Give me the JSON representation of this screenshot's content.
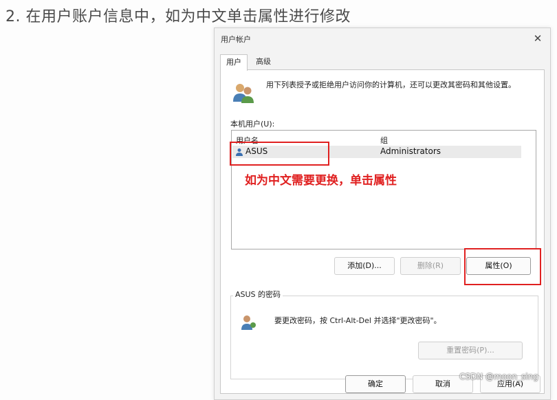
{
  "step_text": "2. 在用户账户信息中，如为中文单击属性进行修改",
  "dialog": {
    "title": "用户帐户",
    "close_glyph": "✕",
    "tabs": [
      {
        "label": "用户",
        "active": true
      },
      {
        "label": "高级",
        "active": false
      }
    ],
    "intro_text": "用下列表授予或拒绝用户访问你的计算机，还可以更改其密码和其他设置。",
    "local_users_label": "本机用户(U):",
    "columns": {
      "name": "用户名",
      "group": "组"
    },
    "users": [
      {
        "name": "ASUS",
        "group": "Administrators",
        "selected": true
      }
    ],
    "buttons": {
      "add": "添加(D)...",
      "remove": "删除(R)",
      "properties": "属性(O)"
    },
    "password_group": {
      "title": "ASUS 的密码",
      "text": "要更改密码，按 Ctrl-Alt-Del 并选择\"更改密码\"。",
      "reset_button": "重置密码(P)..."
    },
    "footer": {
      "ok": "确定",
      "cancel": "取消",
      "apply": "应用(A)"
    }
  },
  "annotation": {
    "text": "如为中文需要更换，单击属性",
    "color": "#e02020"
  },
  "watermark": "CSDN @moon_sing"
}
